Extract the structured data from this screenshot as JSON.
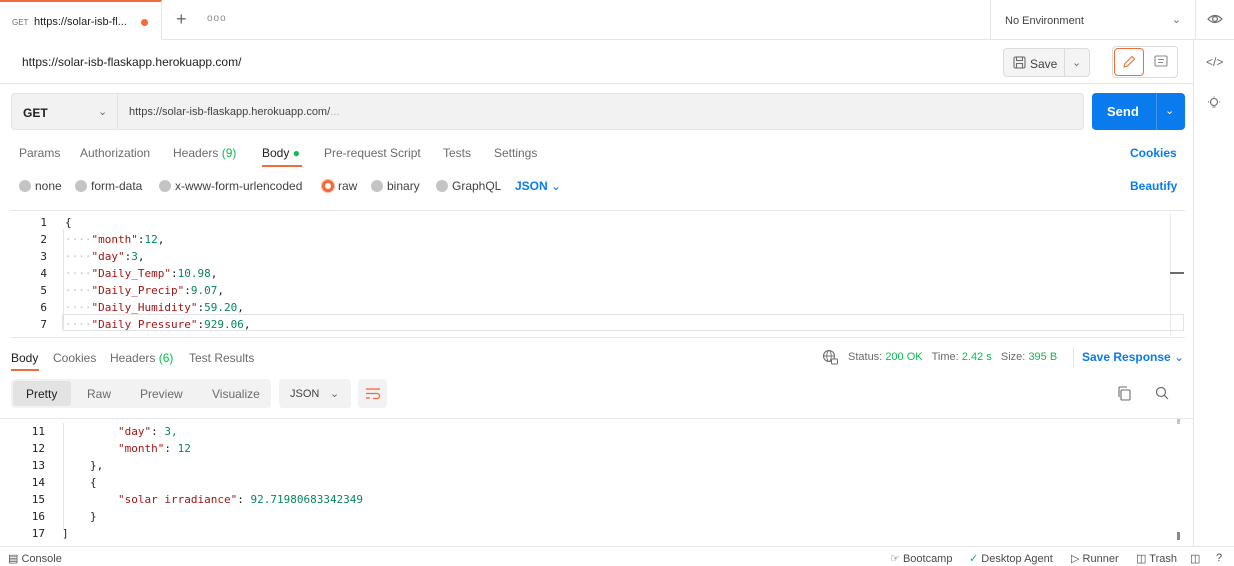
{
  "tab": {
    "method": "GET",
    "title": "https://solar-isb-fl..."
  },
  "environment": "No Environment",
  "request": {
    "title": "https://solar-isb-flaskapp.herokuapp.com/",
    "method": "GET",
    "url": "https://solar-isb-flaskapp.herokuapp.com/",
    "url_suffix": "..."
  },
  "toolbar": {
    "save_label": "Save",
    "send_label": "Send"
  },
  "request_tabs": {
    "params": "Params",
    "authorization": "Authorization",
    "headers": "Headers",
    "headers_count": "(9)",
    "body": "Body",
    "pre_request": "Pre-request Script",
    "tests": "Tests",
    "settings": "Settings",
    "cookies": "Cookies"
  },
  "body_types": {
    "none": "none",
    "form_data": "form-data",
    "urlencoded": "x-www-form-urlencoded",
    "raw": "raw",
    "binary": "binary",
    "graphql": "GraphQL",
    "format": "JSON",
    "beautify": "Beautify"
  },
  "request_body": [
    {
      "n": "1",
      "indent": "",
      "text": "{"
    },
    {
      "n": "2",
      "indent": "····",
      "key": "\"month\"",
      "value": "12"
    },
    {
      "n": "3",
      "indent": "····",
      "key": "\"day\"",
      "value": "3"
    },
    {
      "n": "4",
      "indent": "····",
      "key": "\"Daily_Temp\"",
      "value": "10.98"
    },
    {
      "n": "5",
      "indent": "····",
      "key": "\"Daily_Precip\"",
      "value": "9.07"
    },
    {
      "n": "6",
      "indent": "····",
      "key": "\"Daily_Humidity\"",
      "value": "59.20"
    },
    {
      "n": "7",
      "indent": "····",
      "key": "\"Daily_Pressure\"",
      "value": "929.06"
    }
  ],
  "response_tabs": {
    "body": "Body",
    "cookies": "Cookies",
    "headers": "Headers",
    "headers_count": "(6)",
    "test_results": "Test Results"
  },
  "response_status": {
    "status_label": "Status:",
    "status": "200 OK",
    "time_label": "Time:",
    "time": "2.42 s",
    "size_label": "Size:",
    "size": "395 B",
    "save_response": "Save Response"
  },
  "view_tabs": {
    "pretty": "Pretty",
    "raw": "Raw",
    "preview": "Preview",
    "visualize": "Visualize",
    "format": "JSON"
  },
  "response_body": [
    {
      "n": "11",
      "key": "\"day\"",
      "value": "3,"
    },
    {
      "n": "12",
      "key": "\"month\"",
      "value": "12"
    },
    {
      "n": "13",
      "text": "},"
    },
    {
      "n": "14",
      "text": "{"
    },
    {
      "n": "15",
      "key": "\"solar irradiance\"",
      "value": "92.71980683342349"
    },
    {
      "n": "16",
      "text": "}"
    },
    {
      "n": "17",
      "text": "]"
    }
  ],
  "status_bar": {
    "console": "Console",
    "bootcamp": "Bootcamp",
    "desktop_agent": "Desktop Agent",
    "runner": "Runner",
    "trash": "Trash"
  },
  "colors": {
    "accent": "#f26b3a",
    "primary": "#097bed",
    "success": "#0cbb52"
  }
}
